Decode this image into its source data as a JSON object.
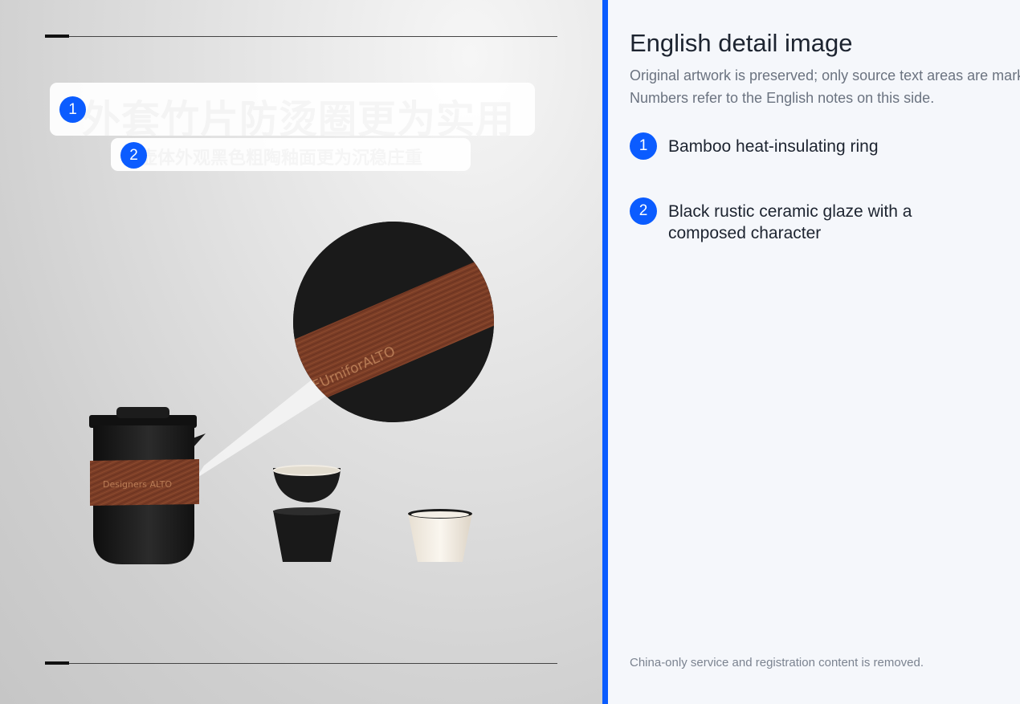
{
  "artwork": {
    "overlay_text_1": "外套竹片防烫圈更为实用",
    "overlay_text_2": "壶体外观黑色粗陶釉面更为沉稳庄重",
    "band_engraving": "FUrniforALTO",
    "pot_band_engraving": "Designers ALTO"
  },
  "markers": [
    "1",
    "2"
  ],
  "panel": {
    "title": "English detail image",
    "intro_line_1": "Original artwork is preserved; only source text areas are marked.",
    "intro_line_2": "Numbers refer to the English notes on this side.",
    "notes": [
      {
        "number": "1",
        "text": "Bamboo heat-insulating ring"
      },
      {
        "number": "2",
        "text": "Black rustic ceramic glaze with a composed character"
      }
    ],
    "footer": "China-only service and registration content is removed."
  },
  "colors": {
    "accent": "#0b5cff",
    "ceramic_black": "#1d1d1d",
    "wood_band": "#7a3d26",
    "panel_bg": "#f5f7fb"
  },
  "icons": [
    "number-badge-icon"
  ]
}
